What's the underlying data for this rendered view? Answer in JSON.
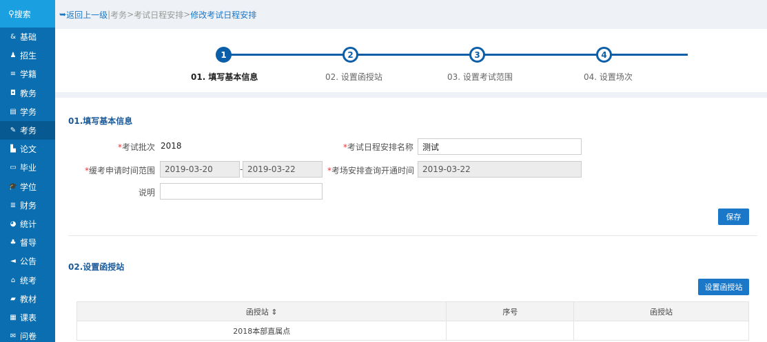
{
  "sidebar": {
    "search": "搜索",
    "items": [
      {
        "icon": "&",
        "label": "基础"
      },
      {
        "icon": "♟",
        "label": "招生"
      },
      {
        "icon": "≡",
        "label": "学籍"
      },
      {
        "icon": "◘",
        "label": "教务"
      },
      {
        "icon": "▤",
        "label": "学务"
      },
      {
        "icon": "✎",
        "label": "考务"
      },
      {
        "icon": "▙",
        "label": "论文"
      },
      {
        "icon": "▭",
        "label": "毕业"
      },
      {
        "icon": "🎓",
        "label": "学位"
      },
      {
        "icon": "≣",
        "label": "财务"
      },
      {
        "icon": "◕",
        "label": "统计"
      },
      {
        "icon": "♣",
        "label": "督导"
      },
      {
        "icon": "◄",
        "label": "公告"
      },
      {
        "icon": "⌂",
        "label": "统考"
      },
      {
        "icon": "▰",
        "label": "教材"
      },
      {
        "icon": "▦",
        "label": "课表"
      },
      {
        "icon": "✉",
        "label": "问卷"
      }
    ],
    "active_index": 5
  },
  "breadcrumb": {
    "back": "返回上一级",
    "sep": "|",
    "path1": "考务",
    "arrow1": ">",
    "path2": "考试日程安排",
    "arrow2": ">",
    "current": "修改考试日程安排"
  },
  "steps": [
    {
      "num": "1",
      "label": "01. 填写基本信息"
    },
    {
      "num": "2",
      "label": "02. 设置函授站"
    },
    {
      "num": "3",
      "label": "03. 设置考试范围"
    },
    {
      "num": "4",
      "label": "04. 设置场次"
    }
  ],
  "basic": {
    "title": "01.填写基本信息",
    "batch_label": "考试批次",
    "batch_value": "2018",
    "name_label": "考试日程安排名称",
    "name_value": "测试",
    "defer_label": "缓考申请时间范围",
    "defer_start": "2019-03-20",
    "dash": "-",
    "defer_end": "2019-03-22",
    "query_label": "考场安排查询开通时间",
    "query_value": "2019-03-22",
    "desc_label": "说明",
    "desc_value": "",
    "required_mark": "*",
    "save": "保存"
  },
  "stations": {
    "title": "02.设置函授站",
    "set_button": "设置函授站",
    "columns": [
      "函授站 ⇕",
      "序号",
      "函授站"
    ],
    "rows": [
      [
        "2018本部直属点",
        "",
        ""
      ]
    ]
  },
  "colors": {
    "sidebar": "#0a6eb0",
    "search": "#1aa0e0",
    "accent": "#1b78c9",
    "step": "#0b5fa8"
  }
}
